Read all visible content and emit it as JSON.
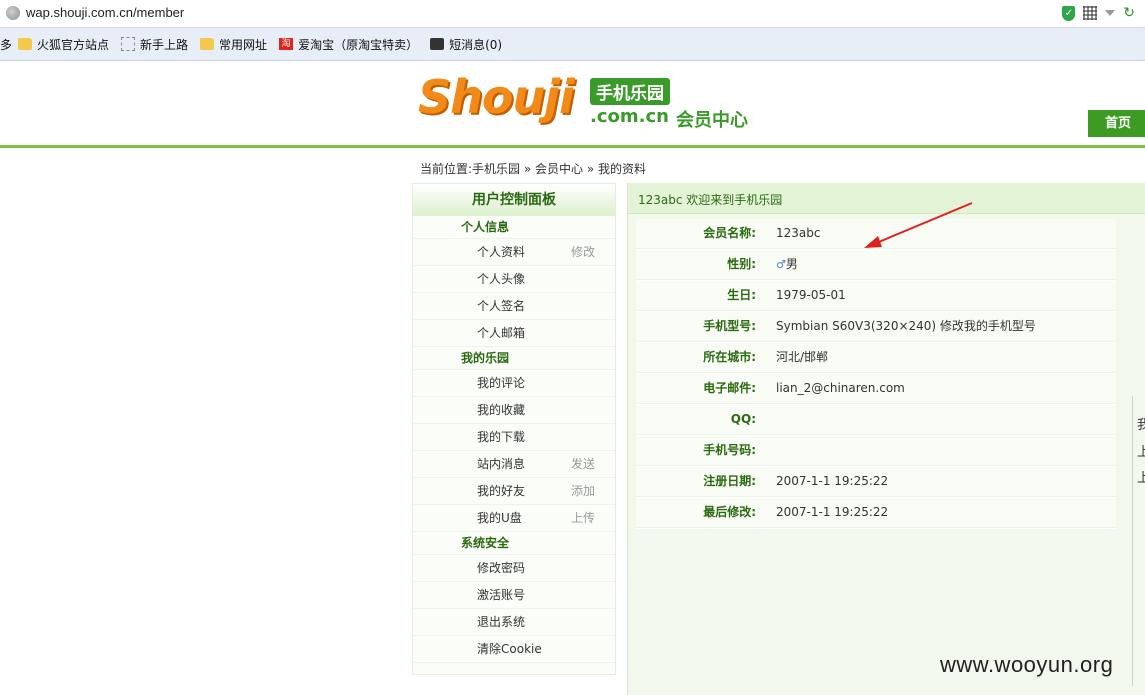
{
  "browser": {
    "url": "wap.shouji.com.cn/member",
    "bookmarks": [
      {
        "label": "多",
        "icon": "none"
      },
      {
        "label": "火狐官方站点",
        "icon": "folder-icon"
      },
      {
        "label": "新手上路",
        "icon": "page-icon"
      },
      {
        "label": "常用网址",
        "icon": "folder-icon"
      },
      {
        "label": "爱淘宝（原淘宝特卖）",
        "icon": "taobao-icon"
      },
      {
        "label": "短消息(0)",
        "icon": "message-icon"
      }
    ]
  },
  "header": {
    "logo_main": "Shouji",
    "logo_tag": "手机乐园",
    "logo_domain": ".com.cn",
    "logo_sub": "会员中心",
    "home": "首页"
  },
  "breadcrumb": {
    "prefix": "当前位置:",
    "items": [
      "手机乐园",
      "会员中心",
      "我的资料"
    ],
    "sep": " » "
  },
  "panel": {
    "title": "用户控制面板",
    "sections": [
      {
        "title": "个人信息",
        "items": [
          {
            "label": "个人资料",
            "action": "修改"
          },
          {
            "label": "个人头像",
            "action": ""
          },
          {
            "label": "个人签名",
            "action": ""
          },
          {
            "label": "个人邮箱",
            "action": ""
          }
        ]
      },
      {
        "title": "我的乐园",
        "items": [
          {
            "label": "我的评论",
            "action": ""
          },
          {
            "label": "我的收藏",
            "action": ""
          },
          {
            "label": "我的下载",
            "action": ""
          },
          {
            "label": "站内消息",
            "action": "发送"
          },
          {
            "label": "我的好友",
            "action": "添加"
          },
          {
            "label": "我的U盘",
            "action": "上传"
          }
        ]
      },
      {
        "title": "系统安全",
        "items": [
          {
            "label": "修改密码",
            "action": ""
          },
          {
            "label": "激活账号",
            "action": ""
          },
          {
            "label": "退出系统",
            "action": ""
          },
          {
            "label": "清除Cookie",
            "action": ""
          }
        ]
      }
    ]
  },
  "main": {
    "welcome": "123abc 欢迎来到手机乐园",
    "fields": [
      {
        "key": "会员名称:",
        "value": "123abc"
      },
      {
        "key": "性别:",
        "value": "男"
      },
      {
        "key": "生日:",
        "value": "1979-05-01"
      },
      {
        "key": "手机型号:",
        "value": "Symbian S60V3(320×240) 修改我的手机型号"
      },
      {
        "key": "所在城市:",
        "value": "河北/邯郸"
      },
      {
        "key": "电子邮件:",
        "value": "lian_2@chinaren.com"
      },
      {
        "key": "QQ:",
        "value": ""
      },
      {
        "key": "手机号码:",
        "value": ""
      },
      {
        "key": "注册日期:",
        "value": "2007-1-1 19:25:22"
      },
      {
        "key": "最后修改:",
        "value": "2007-1-1 19:25:22"
      }
    ],
    "right_fragments": [
      "我",
      "上",
      "上"
    ]
  },
  "watermark": "www.wooyun.org",
  "colors": {
    "accent_green": "#3d9a22",
    "logo_orange": "#f28a1a",
    "arrow_red": "#e02020"
  }
}
